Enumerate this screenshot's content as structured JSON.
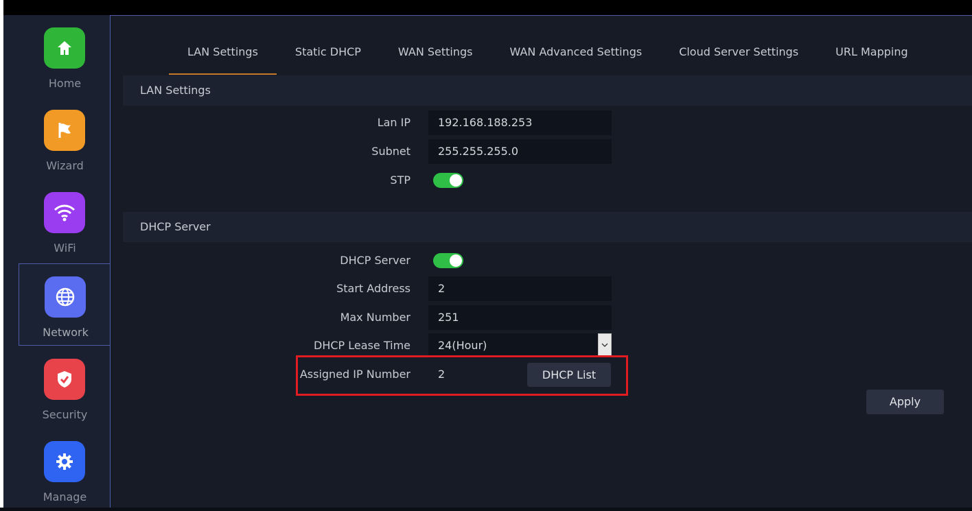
{
  "sidebar": {
    "items": [
      {
        "label": "Home",
        "icon": "home-icon",
        "color": "#2fb639"
      },
      {
        "label": "Wizard",
        "icon": "flag-icon",
        "color": "#f29a26"
      },
      {
        "label": "WiFi",
        "icon": "wifi-icon",
        "color": "#9a3cf0"
      },
      {
        "label": "Network",
        "icon": "globe-icon",
        "color": "#5a6df0"
      },
      {
        "label": "Security",
        "icon": "shield-icon",
        "color": "#e8434a"
      },
      {
        "label": "Manage",
        "icon": "gear-icon",
        "color": "#2f63f2"
      }
    ],
    "active": "Network"
  },
  "tabs": [
    {
      "label": "LAN Settings"
    },
    {
      "label": "Static DHCP"
    },
    {
      "label": "WAN Settings"
    },
    {
      "label": "WAN Advanced Settings"
    },
    {
      "label": "Cloud Server Settings"
    },
    {
      "label": "URL Mapping"
    }
  ],
  "active_tab": "LAN Settings",
  "lan": {
    "title": "LAN Settings",
    "lan_ip_label": "Lan IP",
    "lan_ip": "192.168.188.253",
    "subnet_label": "Subnet",
    "subnet": "255.255.255.0",
    "stp_label": "STP",
    "stp_on": true
  },
  "dhcp": {
    "title": "DHCP Server",
    "server_label": "DHCP Server",
    "server_on": true,
    "start_label": "Start Address",
    "start": "2",
    "max_label": "Max Number",
    "max": "251",
    "lease_label": "DHCP Lease Time",
    "lease": "24(Hour)",
    "assigned_label": "Assigned IP Number",
    "assigned": "2",
    "list_button": "DHCP List"
  },
  "apply_button": "Apply",
  "accent": "#c67a2a",
  "highlight_color": "#e11b22"
}
